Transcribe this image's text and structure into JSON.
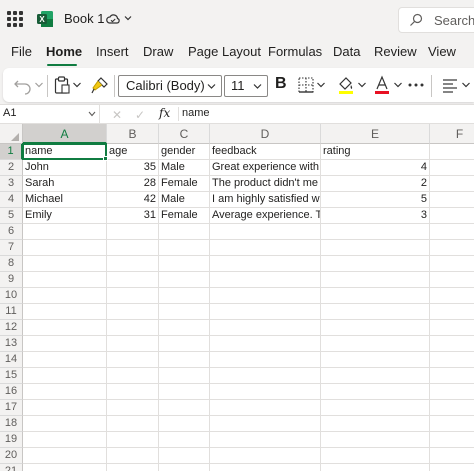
{
  "titlebar": {
    "title": "Book 1",
    "search_label": "Search (",
    "accent_color": "#107c41"
  },
  "menu": {
    "tabs": [
      "File",
      "Home",
      "Insert",
      "Draw",
      "Page Layout",
      "Formulas",
      "Data",
      "Review",
      "View"
    ],
    "active": "Home"
  },
  "ribbon": {
    "font_name": "Calibri (Body)",
    "font_size": "11",
    "bold_label": "B",
    "icons": [
      "undo-icon",
      "clipboard-icon",
      "format-painter-icon",
      "borders-icon",
      "fill-color-icon",
      "font-color-icon",
      "more-icon",
      "align-icon"
    ],
    "fill_color": "#ffff00",
    "font_color": "#e81123"
  },
  "formula_bar": {
    "name_box": "A1",
    "cancel_symbol": "✕",
    "enter_symbol": "✓",
    "fx_label": "fx",
    "formula": "name"
  },
  "sheet": {
    "columns": [
      "A",
      "B",
      "C",
      "D",
      "E",
      "F"
    ],
    "selected_column": "A",
    "row_numbers": [
      "1",
      "2",
      "3",
      "4",
      "5",
      "6",
      "7",
      "8",
      "9",
      "10",
      "11",
      "12",
      "13",
      "14",
      "15",
      "16",
      "17",
      "18",
      "19",
      "20",
      "21"
    ],
    "selected_row": "1",
    "header_row": [
      "name",
      "age",
      "gender",
      "feedback",
      "rating"
    ],
    "rows": [
      [
        "John",
        "35",
        "Male",
        "Great experience with",
        "4"
      ],
      [
        "Sarah",
        "28",
        "Female",
        "The product didn't me",
        "2"
      ],
      [
        "Michael",
        "42",
        "Male",
        "I am highly satisfied wi",
        "5"
      ],
      [
        "Emily",
        "31",
        "Female",
        "Average experience. Th",
        "3"
      ]
    ]
  }
}
